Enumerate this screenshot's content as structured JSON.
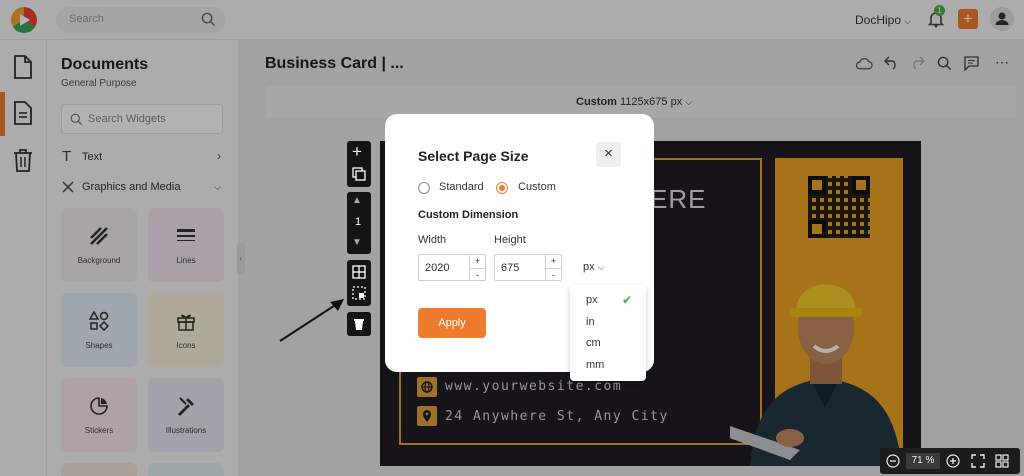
{
  "topbar": {
    "search_placeholder": "Search",
    "brand_label": "DocHipo",
    "notification_count": "1"
  },
  "panel": {
    "title": "Documents",
    "subtitle": "General Purpose",
    "widget_search_placeholder": "Search Widgets",
    "sections": [
      {
        "label": "Text"
      },
      {
        "label": "Graphics and Media"
      }
    ],
    "tiles": [
      {
        "label": "Background",
        "color": "#f1eeea"
      },
      {
        "label": "Lines",
        "color": "#f2e6f2"
      },
      {
        "label": "Shapes",
        "color": "#e6eef8"
      },
      {
        "label": "Icons",
        "color": "#fbf2dc"
      },
      {
        "label": "Stickers",
        "color": "#fbe9ea"
      },
      {
        "label": "Illustrations",
        "color": "#e7e8f4"
      }
    ]
  },
  "editor": {
    "doc_title": "Business Card | ...",
    "size_label_bold": "Custom",
    "size_label_rest": "1125x675 px"
  },
  "card": {
    "headline_fragment": "ERE",
    "website": "www.yourwebsite.com",
    "address": "24 Anywhere St, Any City"
  },
  "vtoolbar": {
    "page_number": "1"
  },
  "zoom": {
    "value": "71 %"
  },
  "modal": {
    "title": "Select Page Size",
    "close_glyph": "×",
    "radio_standard": "Standard",
    "radio_custom": "Custom",
    "selected": "Custom",
    "dimension_title": "Custom Dimension",
    "width_label": "Width",
    "height_label": "Height",
    "width_value": "2020",
    "height_value": "675",
    "unit_value": "px",
    "apply_label": "Apply",
    "unit_options": [
      "px",
      "in",
      "cm",
      "mm"
    ]
  },
  "colors": {
    "accent": "#ef7c2e",
    "card_bg": "#201e25",
    "card_gold": "#f0a526"
  }
}
